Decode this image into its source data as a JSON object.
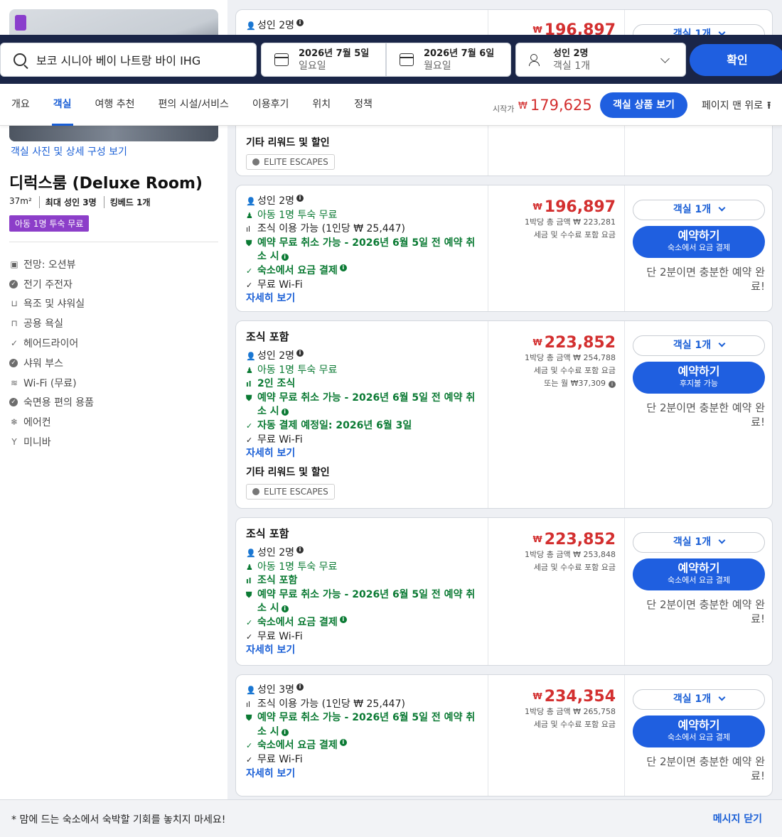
{
  "search": {
    "query": "보코 시니아 베이 나트랑 바이 IHG"
  },
  "dates": {
    "checkin": {
      "date": "2026년 7월 5일",
      "day": "일요일"
    },
    "checkout": {
      "date": "2026년 7월 6일",
      "day": "월요일"
    }
  },
  "guests": {
    "adults": "성인 2명",
    "rooms": "객실 1개"
  },
  "confirm_label": "확인",
  "nav": {
    "tabs": [
      "개요",
      "객실",
      "여행 추천",
      "편의 시설/서비스",
      "이용후기",
      "위치",
      "정책"
    ],
    "active_tab": "객실",
    "from_label": "시작가",
    "currency": "₩",
    "from_price": "179,625",
    "view_rooms_label": "객실 상품 보기",
    "to_top_label": "페이지 맨 위로",
    "to_top_arrow": "⭱"
  },
  "room": {
    "photo_link": "객실 사진 및 상세 구성 보기",
    "title": "디럭스룸 (Deluxe Room)",
    "size": "37m²",
    "max_adults": "최대 성인 3명",
    "bed": "킹베드 1개",
    "kid_badge": "아동 1명 투숙 무료",
    "amenities": [
      {
        "icon": "view-icon",
        "glyph": "▣",
        "label": "전망: 오션뷰"
      },
      {
        "icon": "check-circle-icon",
        "glyph": "✓",
        "label": "전기 주전자",
        "dot": true
      },
      {
        "icon": "bathtub-icon",
        "glyph": "⊔",
        "label": "욕조 및 샤워실"
      },
      {
        "icon": "toilet-icon",
        "glyph": "⊓",
        "label": "공용 욕실"
      },
      {
        "icon": "check-icon",
        "glyph": "✓",
        "label": "헤어드라이어"
      },
      {
        "icon": "check-circle-icon",
        "glyph": "✓",
        "label": "샤워 부스",
        "dot": true
      },
      {
        "icon": "wifi-icon",
        "glyph": "≋",
        "label": "Wi-Fi (무료)"
      },
      {
        "icon": "check-circle-icon",
        "glyph": "✓",
        "label": "숙면용 편의 용품",
        "dot": true
      },
      {
        "icon": "snowflake-icon",
        "glyph": "❄",
        "label": "에어컨"
      },
      {
        "icon": "cocktail-icon",
        "glyph": "Y",
        "label": "미니바"
      }
    ]
  },
  "card0": {
    "guests": "성인 2명",
    "price": "196,897",
    "qty": "객실 1개",
    "reward_heading": "기타 리워드 및 할인",
    "elite": "ELITE ESCAPES"
  },
  "card1": {
    "guests": "성인 2명",
    "kid": "아동 1명 투숙 무료",
    "breakfast": "조식 이용 가능 (1인당 ₩ 25,447)",
    "cancel": "예약 무료 취소 가능 - 2026년 6월 5일 전 예약 취소 시",
    "pay": "숙소에서 요금 결제",
    "wifi": "무료 Wi-Fi",
    "more": "자세히 보기",
    "price": "196,897",
    "total": "1박당 총 금액 ₩ 223,281",
    "tax": "세금 및 수수료 포함 요금",
    "qty": "객실 1개",
    "book": "예약하기",
    "book_sub": "숙소에서 요금 결제",
    "fast": "단 2분이면 충분한 예약 완료!"
  },
  "card2": {
    "heading": "조식 포함",
    "guests": "성인 2명",
    "kid": "아동 1명 투숙 무료",
    "breakfast": "2인 조식",
    "cancel": "예약 무료 취소 가능 - 2026년 6월 5일 전 예약 취소 시",
    "autopay": "자동 결제 예정일: 2026년 6월 3일",
    "wifi": "무료 Wi-Fi",
    "more": "자세히 보기",
    "reward_heading": "기타 리워드 및 할인",
    "elite": "ELITE ESCAPES",
    "price": "223,852",
    "total": "1박당 총 금액 ₩ 254,788",
    "tax": "세금 및 수수료 포함 요금",
    "monthly": "또는 월 ₩37,309",
    "qty": "객실 1개",
    "book": "예약하기",
    "book_sub": "후지불 가능",
    "fast": "단 2분이면 충분한 예약 완료!"
  },
  "card3": {
    "heading": "조식 포함",
    "guests": "성인 2명",
    "kid": "아동 1명 투숙 무료",
    "breakfast": "조식 포함",
    "cancel": "예약 무료 취소 가능 - 2026년 6월 5일 전 예약 취소 시",
    "pay": "숙소에서 요금 결제",
    "wifi": "무료 Wi-Fi",
    "more": "자세히 보기",
    "price": "223,852",
    "total": "1박당 총 금액 ₩ 253,848",
    "tax": "세금 및 수수료 포함 요금",
    "qty": "객실 1개",
    "book": "예약하기",
    "book_sub": "숙소에서 요금 결제",
    "fast": "단 2분이면 충분한 예약 완료!"
  },
  "card4": {
    "guests": "성인 3명",
    "breakfast": "조식 이용 가능 (1인당 ₩ 25,447)",
    "cancel": "예약 무료 취소 가능 - 2026년 6월 5일 전 예약 취소 시",
    "pay": "숙소에서 요금 결제",
    "wifi": "무료 Wi-Fi",
    "more": "자세히 보기",
    "price": "234,354",
    "total": "1박당 총 금액 ₩ 265,758",
    "tax": "세금 및 수수료 포함 요금",
    "qty": "객실 1개",
    "book": "예약하기",
    "book_sub": "숙소에서 요금 결제",
    "fast": "단 2분이면 충분한 예약 완료!"
  },
  "bottom": {
    "message": "* 맘에 드는 숙소에서 숙박할 기회를 놓치지 마세요!",
    "close": "메시지 닫기"
  },
  "colors": {
    "brand_blue": "#1f5fe0",
    "price_red": "#d32f2f",
    "green": "#0a7a33",
    "header_navy": "#1a2547",
    "purple_badge": "#8c3ec9"
  }
}
